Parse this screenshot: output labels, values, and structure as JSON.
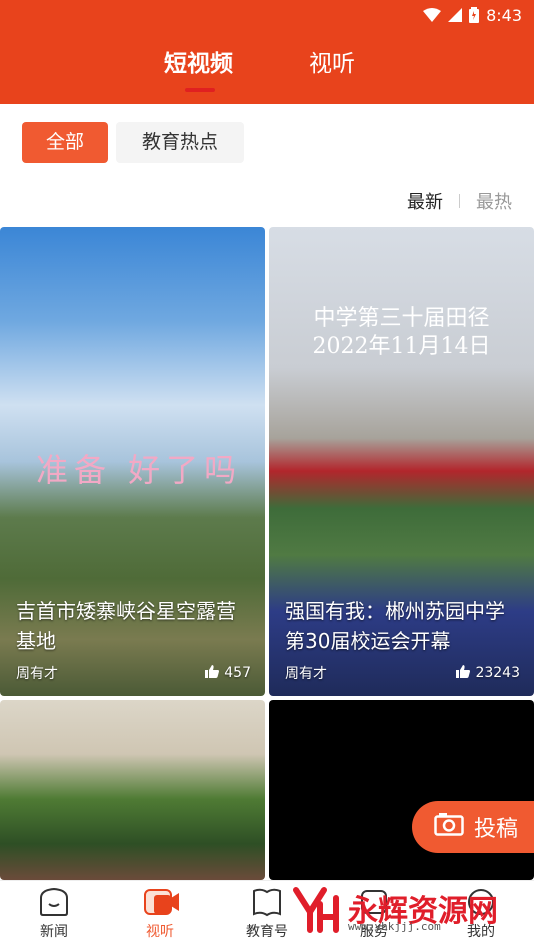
{
  "status_bar": {
    "time": "8:43"
  },
  "header": {
    "tabs": [
      {
        "label": "短视频",
        "active": true
      },
      {
        "label": "视听",
        "active": false
      }
    ]
  },
  "filters": {
    "chips": [
      {
        "label": "全部",
        "active": true
      },
      {
        "label": "教育热点",
        "active": false
      }
    ],
    "sort": {
      "latest": "最新",
      "hottest": "最热"
    }
  },
  "videos": [
    {
      "title": "吉首市矮寨峡谷星空露营基地",
      "author": "周有才",
      "likes": "457",
      "caption": "准备 好了吗"
    },
    {
      "title": "强国有我：郴州苏园中学第30届校运会开幕",
      "author": "周有才",
      "likes": "23243",
      "caption_line1": "中学第三十届田径",
      "caption_line2": "2022年11月14日"
    },
    {
      "title": "",
      "author": "",
      "likes": ""
    },
    {
      "title": "",
      "author": "",
      "likes": ""
    }
  ],
  "submit_button": {
    "label": "投稿"
  },
  "bottom_nav": [
    {
      "label": "新闻",
      "icon": "news-icon",
      "active": false
    },
    {
      "label": "视听",
      "icon": "video-icon",
      "active": true
    },
    {
      "label": "教育号",
      "icon": "book-icon",
      "active": false
    },
    {
      "label": "服务",
      "icon": "service-icon",
      "active": false
    },
    {
      "label": "我的",
      "icon": "profile-icon",
      "active": false
    }
  ],
  "watermark": {
    "text": "永辉资源网",
    "url": "www.yhkjjj.com"
  },
  "colors": {
    "brand": "#e8431c",
    "accent": "#f05a31"
  }
}
